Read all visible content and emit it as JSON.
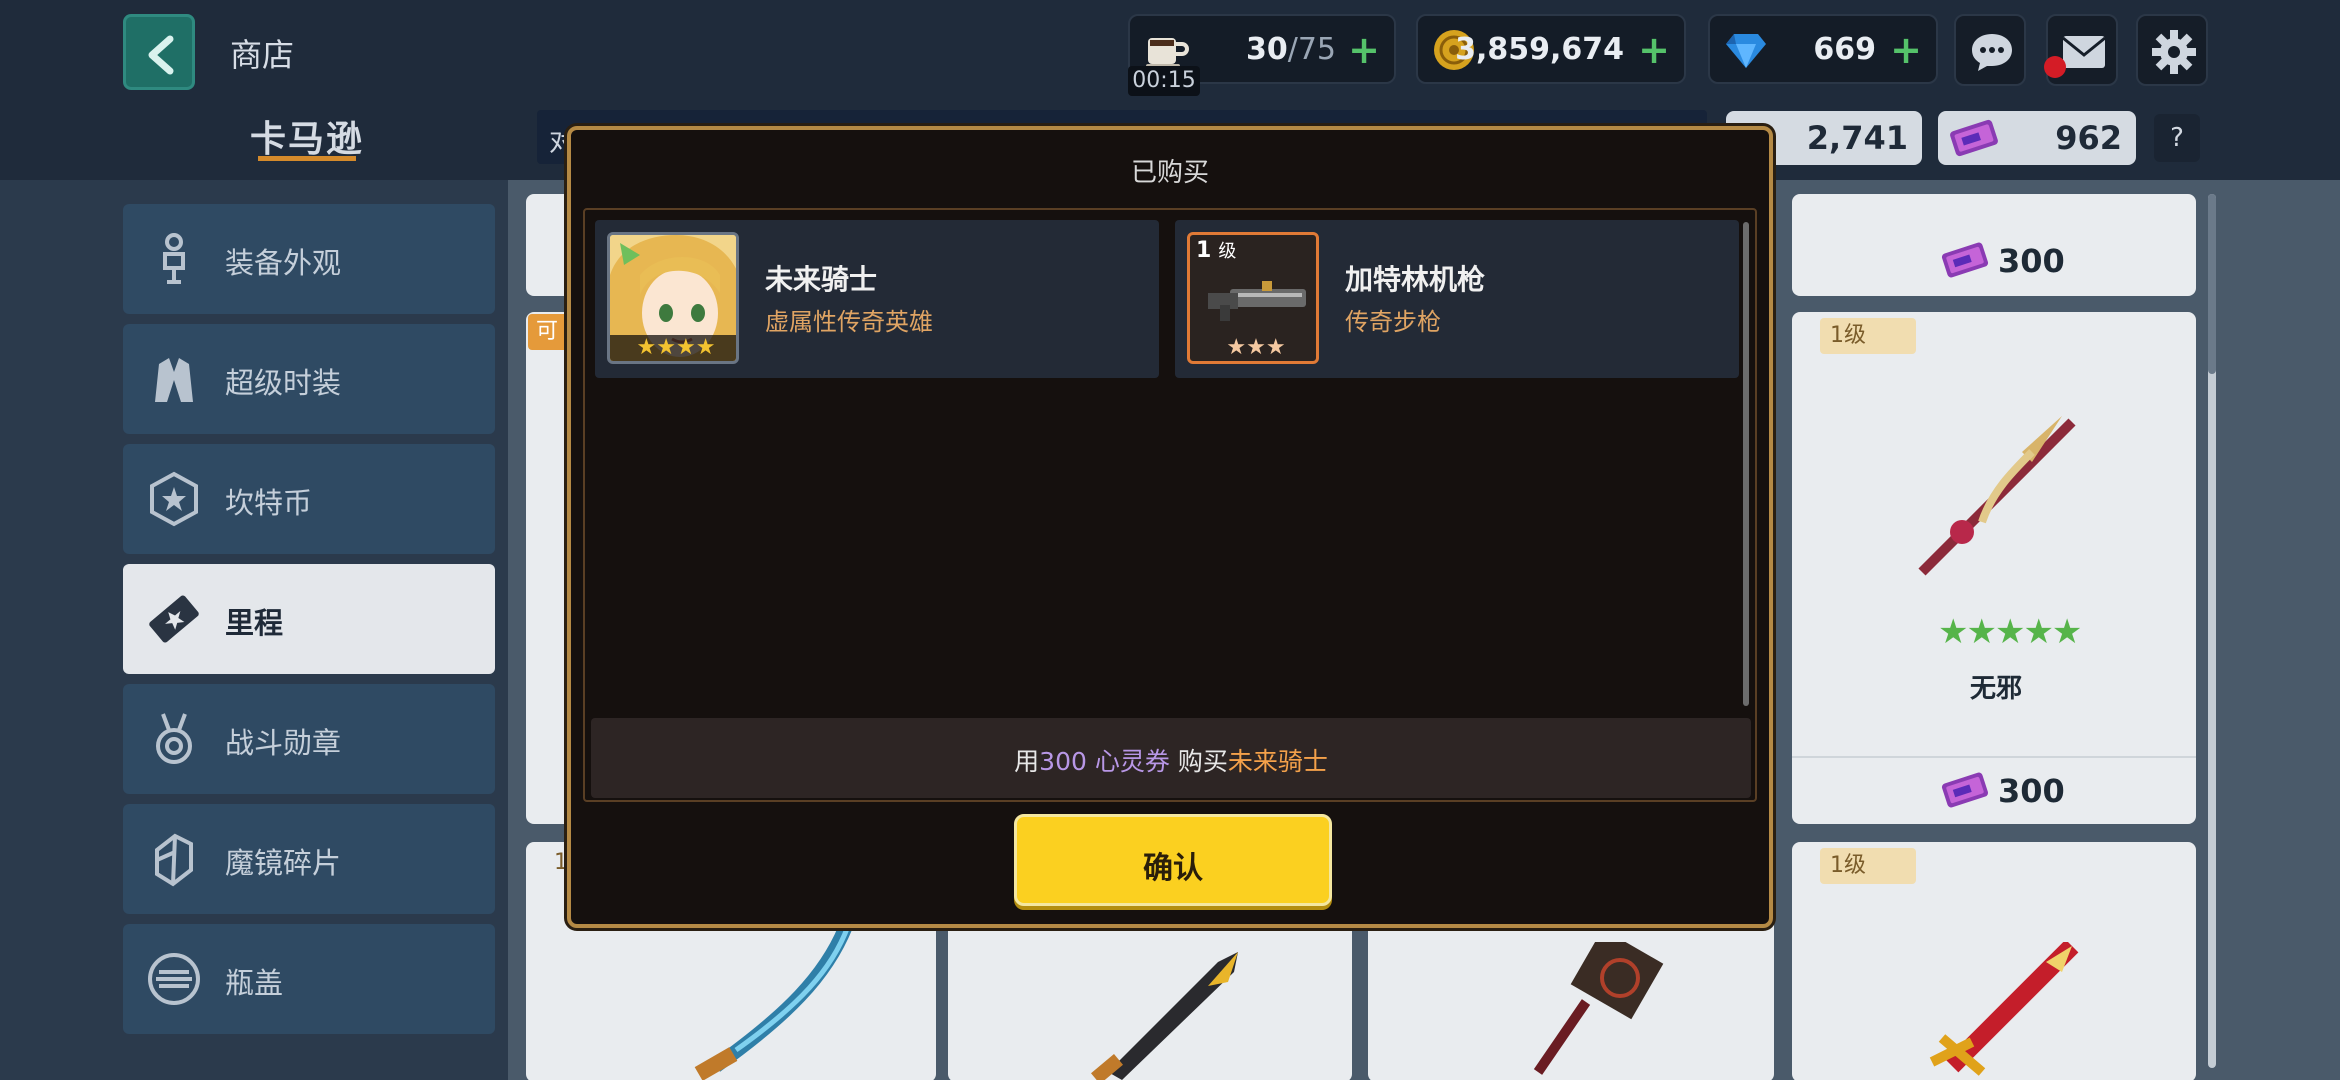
{
  "header": {
    "title": "商店",
    "stamina": {
      "value": "30",
      "max": "/75",
      "timer": "00:15"
    },
    "gold": "3,859,674",
    "gems": "669",
    "plus": "+"
  },
  "shop": {
    "logo": "卡马逊",
    "search_prefix": "对",
    "currency_a": "2,741",
    "currency_b": "962",
    "help": "?"
  },
  "sidebar": {
    "items": [
      {
        "label": "装备外观",
        "icon": "statue-icon"
      },
      {
        "label": "超级时装",
        "icon": "costume-icon"
      },
      {
        "label": "坎特币",
        "icon": "coin-badge-icon"
      },
      {
        "label": "里程",
        "icon": "ticket-icon",
        "active": true
      },
      {
        "label": "战斗勋章",
        "icon": "medal-icon"
      },
      {
        "label": "魔镜碎片",
        "icon": "shard-icon"
      },
      {
        "label": "瓶盖",
        "icon": "bottlecap-icon"
      }
    ]
  },
  "grid": {
    "card_top_right_price": "300",
    "card_mid_right": {
      "level": "1级",
      "stars": "★★★★★",
      "name": "无邪",
      "price": "300"
    },
    "card_bottom_right_level": "1级",
    "card_left_badge": "可",
    "card_bottom_left_level": "1"
  },
  "modal": {
    "title": "已购买",
    "items": [
      {
        "name": "未来骑士",
        "subtitle": "虚属性传奇英雄",
        "stars": "★★★★"
      },
      {
        "name": "加特林机枪",
        "subtitle": "传奇步枪",
        "level_num": "1",
        "level_unit": "级",
        "stars": "★★★"
      }
    ],
    "summary": {
      "prefix": "用",
      "amount": "300",
      "currency": "心灵券",
      "middle": "购买",
      "target": "未来骑士"
    },
    "confirm": "确认"
  },
  "colors": {
    "accent_yellow": "#fbd020",
    "modal_border": "#b58a45",
    "topbar": "#1f2b3b",
    "sidebar_item": "#2f4a63"
  }
}
